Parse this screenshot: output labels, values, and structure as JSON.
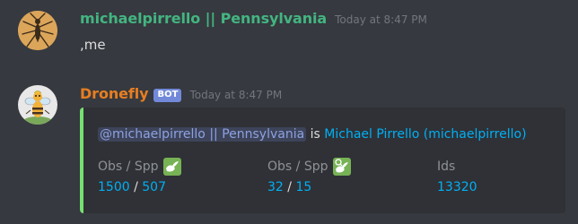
{
  "messages": [
    {
      "username": "michaelpirrello || Pennsylvania",
      "username_color": "#43b581",
      "timestamp": "Today at 8:47 PM",
      "text": ",me"
    },
    {
      "username": "Dronefly",
      "username_color": "#e67e22",
      "bot_tag": "BOT",
      "timestamp": "Today at 8:47 PM",
      "embed": {
        "accent_color": "#77e072",
        "mention": "@michaelpirrello || Pennsylvania",
        "connector": "is",
        "profile_link": "Michael Pirrello (michaelpirrello)",
        "fields": [
          {
            "name": "Obs / Spp",
            "icon": "bird-icon",
            "value_a": "1500",
            "separator": "/",
            "value_b": "507"
          },
          {
            "name": "Obs / Spp",
            "icon": "bird-id-icon",
            "value_a": "32",
            "separator": "/",
            "value_b": "15"
          },
          {
            "name": "Ids",
            "value": "13320"
          }
        ]
      }
    }
  ],
  "colors": {
    "background": "#36393f",
    "embed_background": "#2f3136",
    "link": "#00b0f4",
    "bot_tag": "#7289da",
    "timestamp": "#72767d"
  }
}
